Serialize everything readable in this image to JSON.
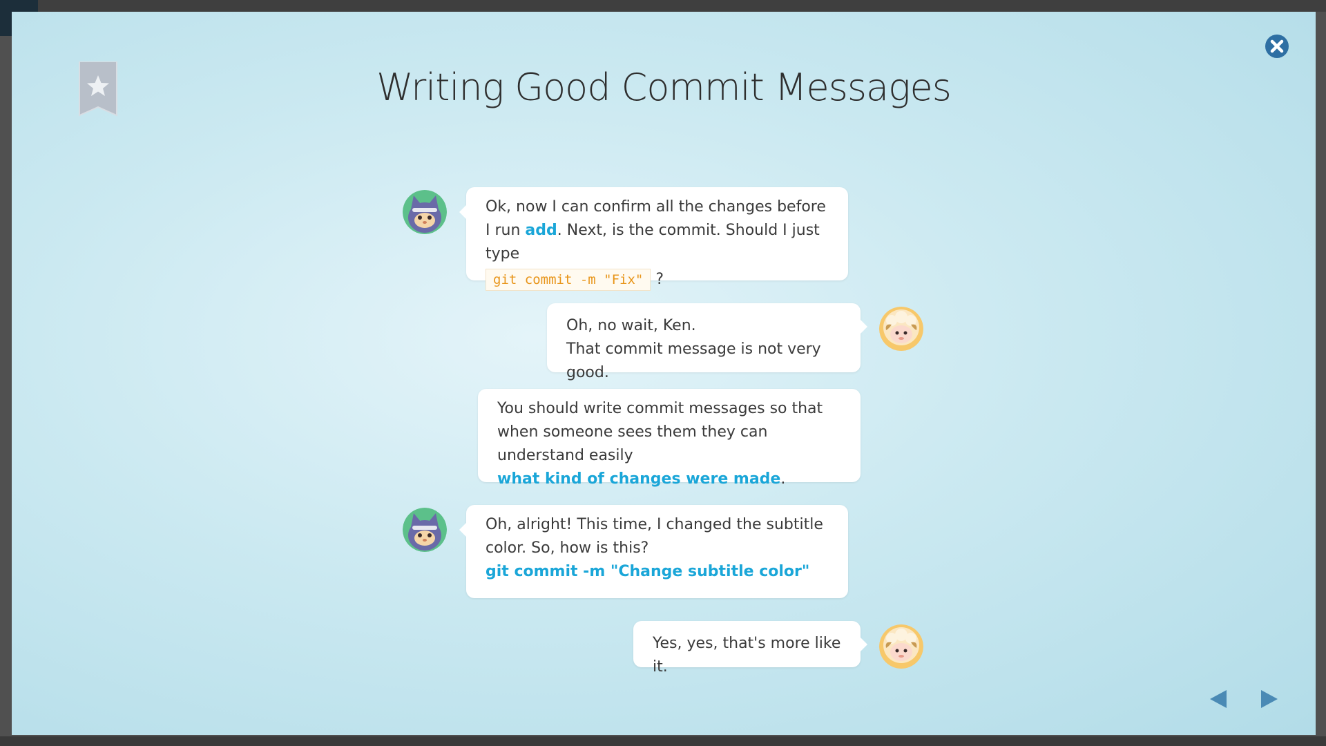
{
  "page": {
    "title": "Writing Good Commit Messages"
  },
  "conversation": {
    "messages": [
      {
        "speaker": "ken",
        "side": "left",
        "segments": [
          {
            "text": "Ok, now I can confirm all the changes before I run ",
            "style": "plain"
          },
          {
            "text": "add",
            "style": "highlight"
          },
          {
            "text": ". Next, is the commit. Should I just type ",
            "style": "plain"
          },
          {
            "text": "git commit -m \"Fix\"",
            "style": "code"
          },
          {
            "text": " ?",
            "style": "plain"
          }
        ]
      },
      {
        "speaker": "sheep",
        "side": "right",
        "lines": [
          "Oh, no wait, Ken.",
          "That commit message is not very good."
        ]
      },
      {
        "speaker": "sheep",
        "side": "right",
        "segments": [
          {
            "text": "You should write commit messages so that when someone sees them they can understand easily ",
            "style": "plain"
          },
          {
            "text": "what kind of changes were made",
            "style": "highlight"
          },
          {
            "text": ".",
            "style": "plain"
          }
        ]
      },
      {
        "speaker": "ken",
        "side": "left",
        "segments": [
          {
            "text": "Oh, alright! This time, I changed the subtitle color. So, how is this?",
            "style": "plain"
          },
          {
            "text": "git commit -m \"Change subtitle color\"",
            "style": "highlight"
          }
        ]
      },
      {
        "speaker": "sheep",
        "side": "right",
        "lines": [
          "Yes, yes, that's more like it."
        ]
      }
    ]
  },
  "icons": {
    "bookmark": "star-bookmark-icon",
    "close": "close-circle-icon",
    "prev": "triangle-left-icon",
    "next": "triangle-right-icon",
    "avatar_ken": "cat-avatar-icon",
    "avatar_sheep": "sheep-avatar-icon"
  },
  "colors": {
    "highlight": "#1aa6d8",
    "code": "#e8951a",
    "close": "#2e6fa3",
    "nav": "#4a8ab5",
    "bookmark": "#b8bfc9"
  }
}
